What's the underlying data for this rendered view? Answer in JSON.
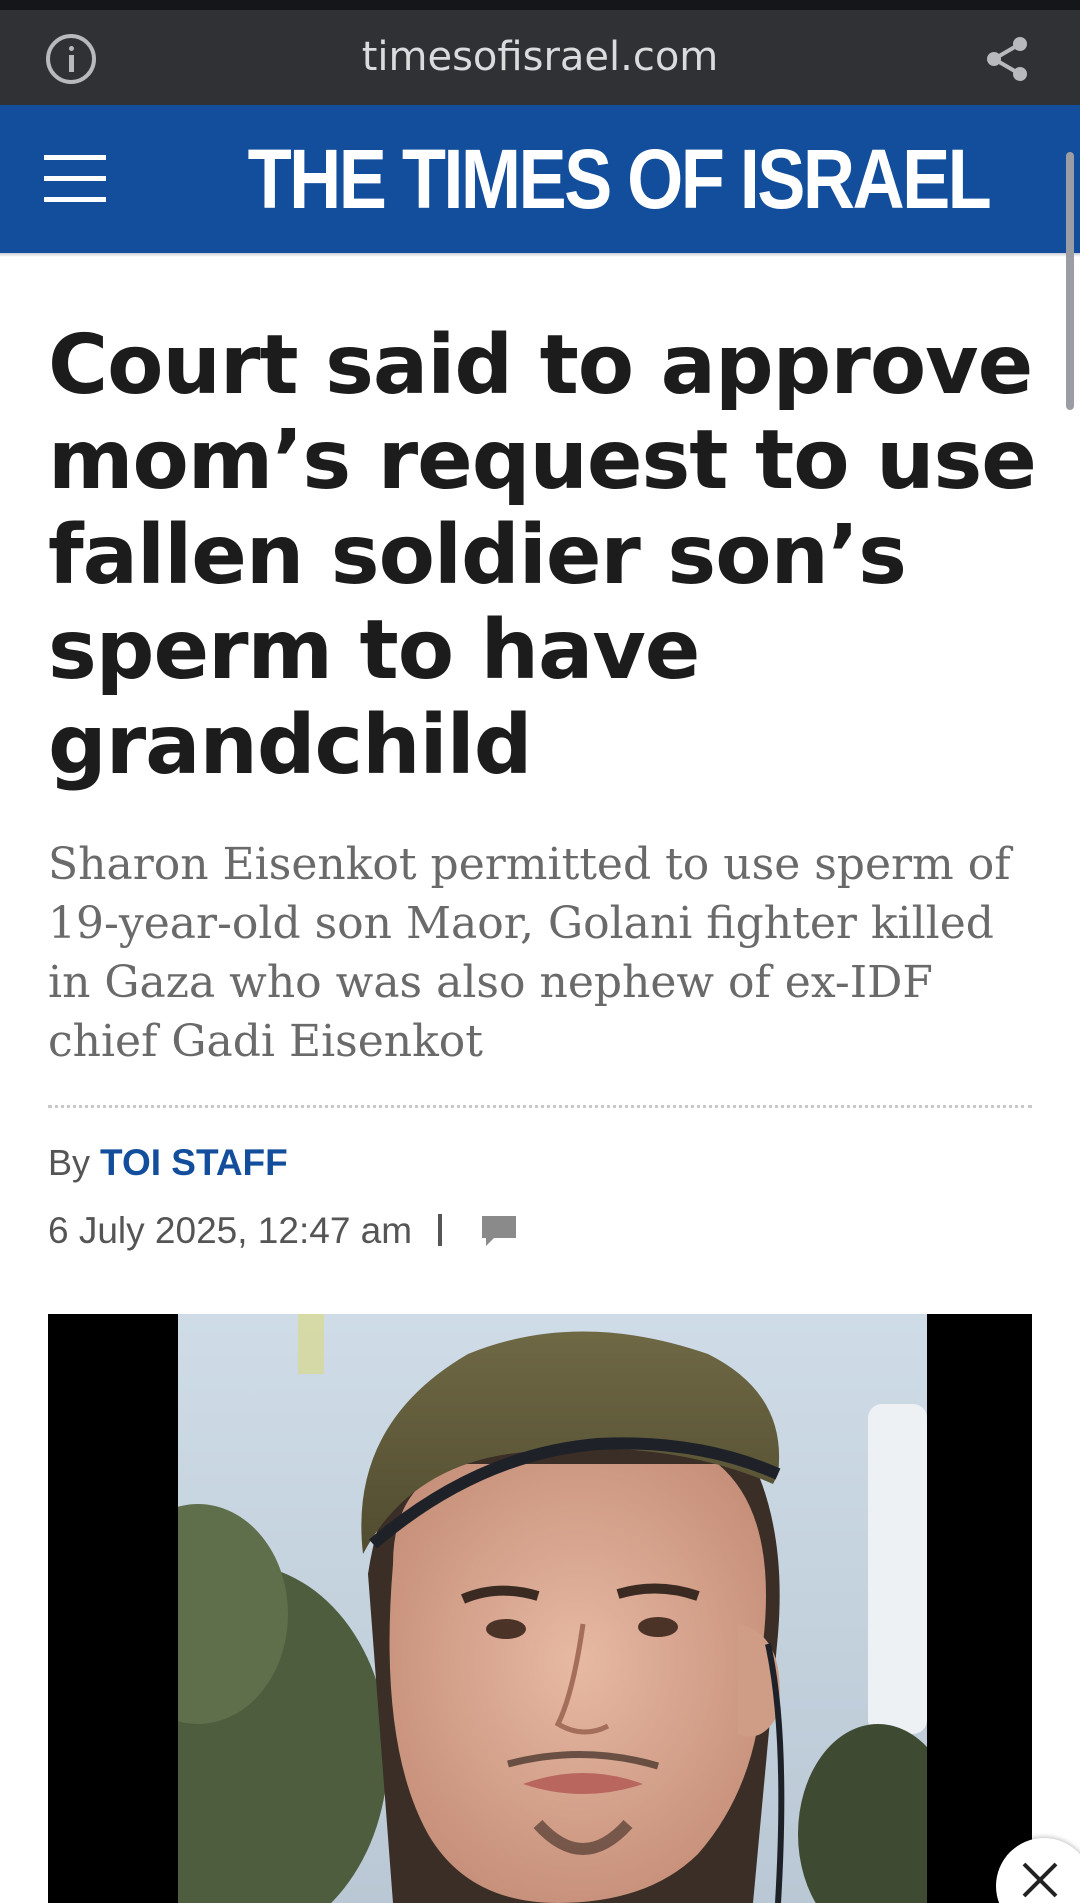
{
  "browser": {
    "url": "timesofisrael.com",
    "info_icon": "info-circle-icon",
    "share_icon": "share-icon"
  },
  "site": {
    "logo": "THE TIMES OF ISRAEL",
    "menu_icon": "hamburger-menu-icon",
    "brand_color": "#124e9c"
  },
  "article": {
    "headline": "Court said to approve mom’s request to use fallen soldier son’s sperm to have grandchild",
    "subheadline": "Sharon Eisenkot permitted to use sperm of 19-year-old son Maor, Golani fighter killed in Gaza who was also nephew of ex-IDF chief Gadi Eisenkot",
    "byline_prefix": "By",
    "author": "TOI STAFF",
    "date": "6 July 2025, 12:47 am",
    "comment_icon": "comment-icon"
  },
  "overlay": {
    "close_icon": "close-icon"
  }
}
